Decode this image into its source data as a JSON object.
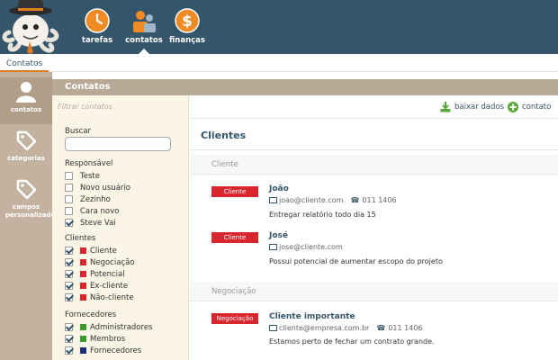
{
  "nav": {
    "items": [
      {
        "label": "tarefas",
        "color": "#f08a24"
      },
      {
        "label": "contatos",
        "color": "#f08a24"
      },
      {
        "label": "finanças",
        "color": "#f08a24"
      }
    ]
  },
  "breadcrumb": {
    "label": "Contatos"
  },
  "rail": {
    "items": [
      {
        "label": "contatos"
      },
      {
        "label": "categorias"
      },
      {
        "label": "campos personalizados"
      }
    ]
  },
  "page": {
    "title": "Contatos"
  },
  "filters": {
    "filter_placeholder": "Filtrar contatos",
    "search_label": "Buscar",
    "search_value": "",
    "responsavel_label": "Responsável",
    "responsavel": [
      {
        "label": "Teste",
        "checked": false
      },
      {
        "label": "Novo usuário",
        "checked": false
      },
      {
        "label": "Zezinho",
        "checked": false
      },
      {
        "label": "Cara novo",
        "checked": false
      },
      {
        "label": "Steve Vai",
        "checked": true
      }
    ],
    "clientes_label": "Clientes",
    "clientes": [
      {
        "label": "Cliente",
        "checked": true,
        "color": "#d9262e"
      },
      {
        "label": "Negociação",
        "checked": true,
        "color": "#d9262e"
      },
      {
        "label": "Potencial",
        "checked": true,
        "color": "#d9262e"
      },
      {
        "label": "Ex-cliente",
        "checked": true,
        "color": "#d9262e"
      },
      {
        "label": "Não-cliente",
        "checked": true,
        "color": "#d9262e"
      }
    ],
    "fornecedores_label": "Fornecedores",
    "fornecedores": [
      {
        "label": "Administradores",
        "checked": true,
        "color": "#3a9a2f"
      },
      {
        "label": "Membros",
        "checked": true,
        "color": "#3a9a2f"
      },
      {
        "label": "Fornecedores",
        "checked": true,
        "color": "#1c2f7a"
      }
    ]
  },
  "toolbar": {
    "download_label": "baixar dados",
    "add_label": "contato"
  },
  "main": {
    "section_title": "Clientes",
    "groups": [
      {
        "label": "Cliente"
      },
      {
        "label": "Negociação"
      }
    ],
    "contacts": [
      {
        "badge": "Cliente",
        "name": "João",
        "email": "joao@cliente.com",
        "phone": "011 1406",
        "note": "Entregar relatório todo dia 15"
      },
      {
        "badge": "Cliente",
        "name": "José",
        "email": "jose@cliente.com",
        "phone": "",
        "note": "Possui potencial de aumentar escopo do projeto"
      },
      {
        "badge": "Negociação",
        "name": "Cliente importante",
        "email": "cliente@empresa.com.br",
        "phone": "011 1406",
        "note": "Estamos perto de fechar um contrato grande."
      }
    ]
  }
}
